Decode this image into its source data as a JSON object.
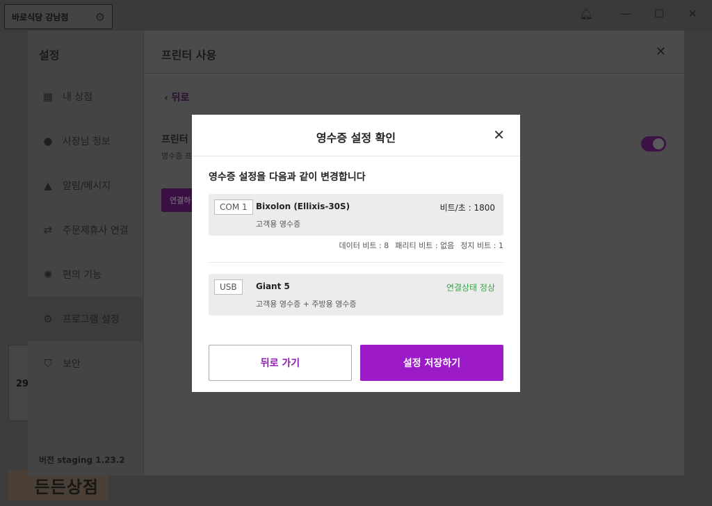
{
  "topbar": {
    "store_name": "바로식당 강남점",
    "icons": [
      "gear-icon",
      "bell-icon",
      "minimize-icon",
      "maximize-icon",
      "close-icon"
    ]
  },
  "background": {
    "promo_number": "29",
    "logo_text": "든든상점"
  },
  "settings": {
    "title": "설정",
    "sidebar": {
      "items": [
        {
          "label": "내 상점",
          "icon": "store-icon"
        },
        {
          "label": "사장님 정보",
          "icon": "user-icon"
        },
        {
          "label": "알림/메시지",
          "icon": "bell-icon"
        },
        {
          "label": "주문제휴사 연결",
          "icon": "swap-icon"
        },
        {
          "label": "편의 기능",
          "icon": "bulb-icon"
        },
        {
          "label": "프로그램 설정",
          "icon": "gear-icon"
        },
        {
          "label": "보안",
          "icon": "shield-icon"
        }
      ],
      "active_index": 5,
      "version": "버전 staging 1.23.2"
    },
    "main": {
      "title": "프린터 사용",
      "back_label": "뒤로",
      "printer_label": "프린터 사",
      "printer_sub": "영수증 프",
      "connect_label": "연결하",
      "toggle_on": true
    }
  },
  "modal": {
    "title": "영수증 설정 확인",
    "description": "영수증 설정을 다음과 같이 변경합니다",
    "devices": [
      {
        "port": "COM 1",
        "model": "Bixolon (Ellixis-30S)",
        "usage": "고객용 영수증",
        "right_text": "비트/초 : 1800"
      },
      {
        "port": "USB",
        "model": "Giant 5",
        "usage": "고객용 영수증 + 주방용 영수증",
        "right_text": "연결상태 정상"
      }
    ],
    "serial_settings": {
      "data_bits": "데이터 비트 : 8",
      "parity": "패리티 비트 : 없음",
      "stop_bits": "정지 비트 : 1"
    },
    "back_button": "뒤로 가기",
    "save_button": "설정 저장하기"
  },
  "colors": {
    "accent": "#9c1ac8",
    "status_ok": "#3aa54a",
    "overlay": "#3d3d3d"
  }
}
